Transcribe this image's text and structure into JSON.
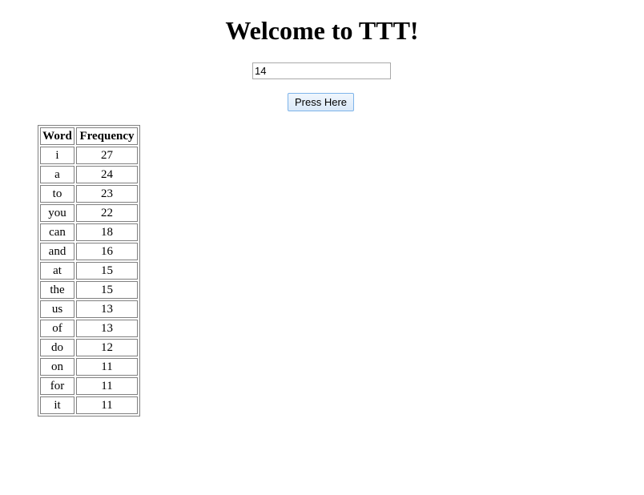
{
  "header": {
    "title": "Welcome to TTT!"
  },
  "form": {
    "input_value": "14",
    "button_label": "Press Here"
  },
  "table": {
    "columns": [
      "Word",
      "Frequency"
    ],
    "rows": [
      {
        "word": "i",
        "frequency": "27"
      },
      {
        "word": "a",
        "frequency": "24"
      },
      {
        "word": "to",
        "frequency": "23"
      },
      {
        "word": "you",
        "frequency": "22"
      },
      {
        "word": "can",
        "frequency": "18"
      },
      {
        "word": "and",
        "frequency": "16"
      },
      {
        "word": "at",
        "frequency": "15"
      },
      {
        "word": "the",
        "frequency": "15"
      },
      {
        "word": "us",
        "frequency": "13"
      },
      {
        "word": "of",
        "frequency": "13"
      },
      {
        "word": "do",
        "frequency": "12"
      },
      {
        "word": "on",
        "frequency": "11"
      },
      {
        "word": "for",
        "frequency": "11"
      },
      {
        "word": "it",
        "frequency": "11"
      }
    ]
  }
}
